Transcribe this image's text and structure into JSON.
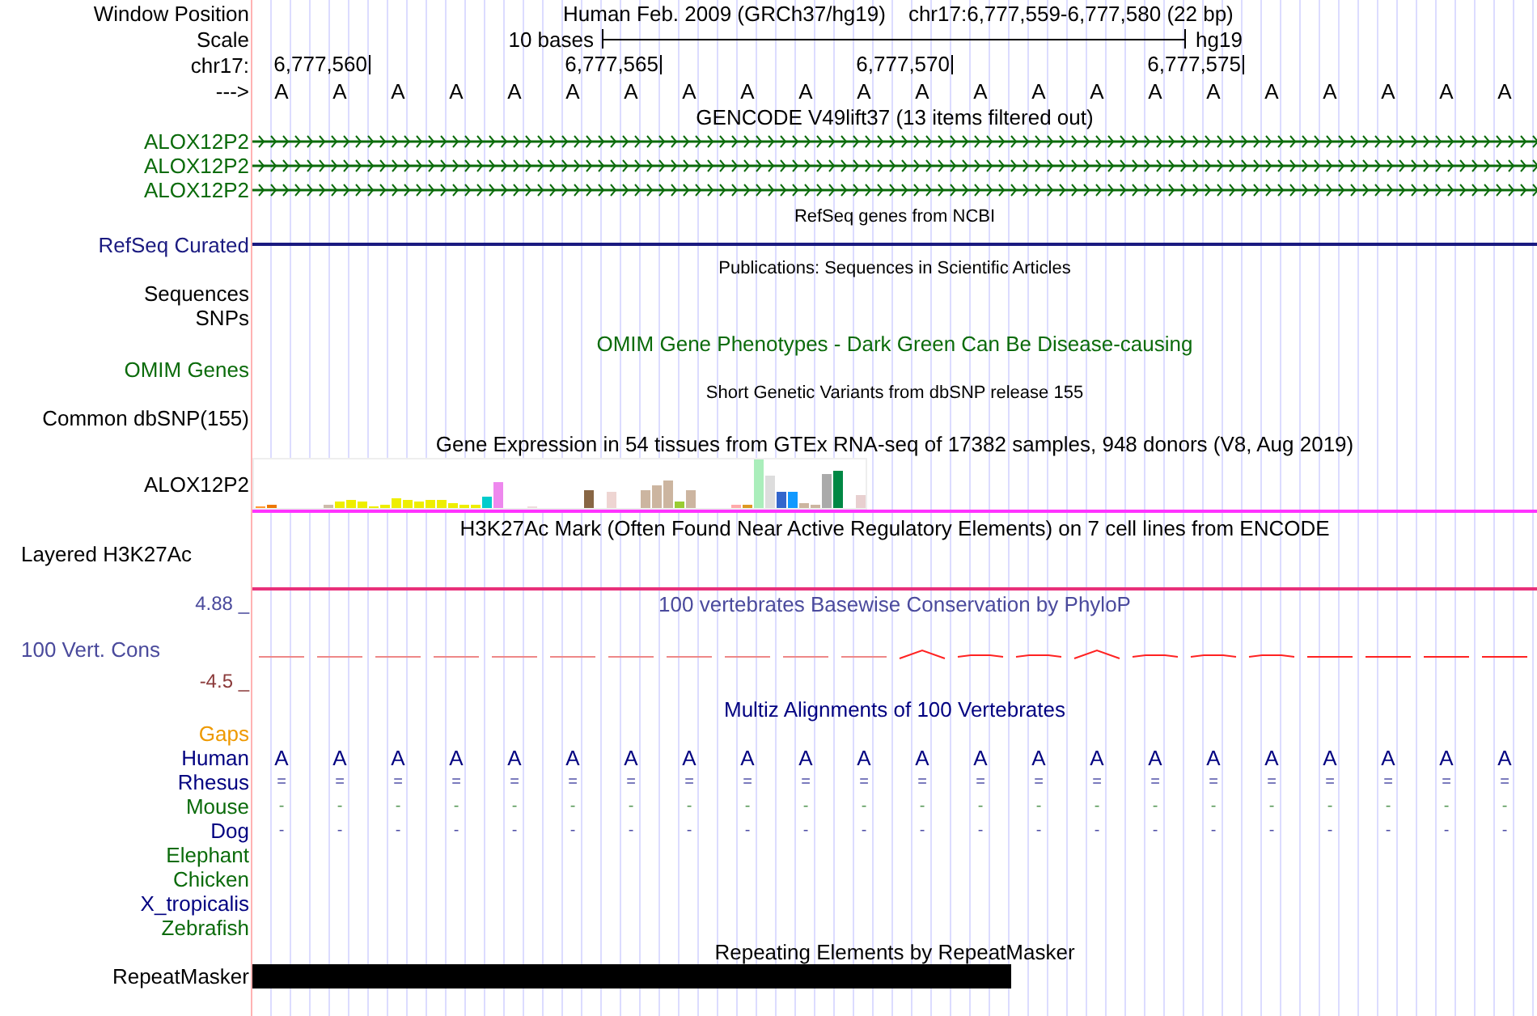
{
  "header": {
    "label": "Window Position",
    "assembly": "Human Feb. 2009 (GRCh37/hg19)",
    "range": "chr17:6,777,559-6,777,580 (22 bp)"
  },
  "scale": {
    "label": "Scale",
    "bar_label": "10 bases",
    "assembly": "hg19"
  },
  "ruler": {
    "label": "chr17:",
    "ticks": [
      "6,777,560",
      "6,777,565",
      "6,777,570",
      "6,777,575"
    ]
  },
  "sequence": {
    "label": "--->",
    "bases": [
      "A",
      "A",
      "A",
      "A",
      "A",
      "A",
      "A",
      "A",
      "A",
      "A",
      "A",
      "A",
      "A",
      "A",
      "A",
      "A",
      "A",
      "A",
      "A",
      "A",
      "A",
      "A"
    ]
  },
  "tracks": [
    {
      "kind": "gene",
      "color": "#000000",
      "title": "GENCODE V49lift37 (13 items filtered out)",
      "items": [
        {
          "label": "ALOX12P2"
        },
        {
          "label": "ALOX12P2"
        },
        {
          "label": "ALOX12P2"
        }
      ]
    },
    {
      "kind": "line",
      "color": "#000000",
      "title": "RefSeq genes from NCBI",
      "label": "RefSeq Curated"
    },
    {
      "kind": "sparse",
      "color": "#000000",
      "title": "Publications: Sequences in Scientific Articles",
      "labels": [
        "Sequences",
        "SNPs"
      ]
    },
    {
      "kind": "phenotype",
      "color": "#0b6b0b",
      "title": "OMIM Gene Phenotypes - Dark Green Can Be Disease-causing",
      "labels": [
        "OMIM Genes"
      ]
    },
    {
      "kind": "sparse",
      "color": "#000000",
      "title": "Short Genetic Variants from dbSNP release 155",
      "labels": [
        "Common dbSNP(155)"
      ]
    },
    {
      "kind": "expression",
      "color": "#000000",
      "title": "Gene Expression in 54 tissues from GTEx RNA-seq of 17382 samples, 948 donors (V8, Aug 2019)",
      "label": "ALOX12P2"
    },
    {
      "kind": "layered",
      "color": "#000000",
      "title": "H3K27Ac Mark (Often Found Near Active Regulatory Elements) on 7 cell lines from ENCODE",
      "label": "Layered H3K27Ac"
    },
    {
      "kind": "wiggle",
      "color": "#4a4a9c",
      "title": "100 vertebrates Basewise Conservation by PhyloP",
      "label": "100 Vert. Cons",
      "max": "4.88 _",
      "min": "-4.5 _"
    },
    {
      "kind": "alignment",
      "color": "#000080",
      "title": "Multiz Alignments of 100 Vertebrates",
      "species": [
        {
          "name": "Gaps",
          "color": "#ee9900"
        },
        {
          "name": "Human",
          "color": "#000080",
          "bases": [
            "A",
            "A",
            "A",
            "A",
            "A",
            "A",
            "A",
            "A",
            "A",
            "A",
            "A",
            "A",
            "A",
            "A",
            "A",
            "A",
            "A",
            "A",
            "A",
            "A",
            "A",
            "A"
          ]
        },
        {
          "name": "Rhesus",
          "color": "#000080",
          "bases": [
            "=",
            "=",
            "=",
            "=",
            "=",
            "=",
            "=",
            "=",
            "=",
            "=",
            "=",
            "=",
            "=",
            "=",
            "=",
            "=",
            "=",
            "=",
            "=",
            "=",
            "=",
            "="
          ]
        },
        {
          "name": "Mouse",
          "color": "#0b6b0b",
          "bases": [
            "-",
            "-",
            "-",
            "-",
            "-",
            "-",
            "-",
            "-",
            "-",
            "-",
            "-",
            "-",
            "-",
            "-",
            "-",
            "-",
            "-",
            "-",
            "-",
            "-",
            "-",
            "-"
          ]
        },
        {
          "name": "Dog",
          "color": "#000080",
          "bases": [
            "-",
            "-",
            "-",
            "-",
            "-",
            "-",
            "-",
            "-",
            "-",
            "-",
            "-",
            "-",
            "-",
            "-",
            "-",
            "-",
            "-",
            "-",
            "-",
            "-",
            "-",
            "-"
          ]
        },
        {
          "name": "Elephant",
          "color": "#0b6b0b"
        },
        {
          "name": "Chicken",
          "color": "#0b6b0b"
        },
        {
          "name": "X_tropicalis",
          "color": "#000080"
        },
        {
          "name": "Zebrafish",
          "color": "#0b6b0b"
        }
      ]
    },
    {
      "kind": "bar",
      "color": "#000000",
      "title": "Repeating Elements by RepeatMasker",
      "label": "RepeatMasker"
    }
  ]
}
